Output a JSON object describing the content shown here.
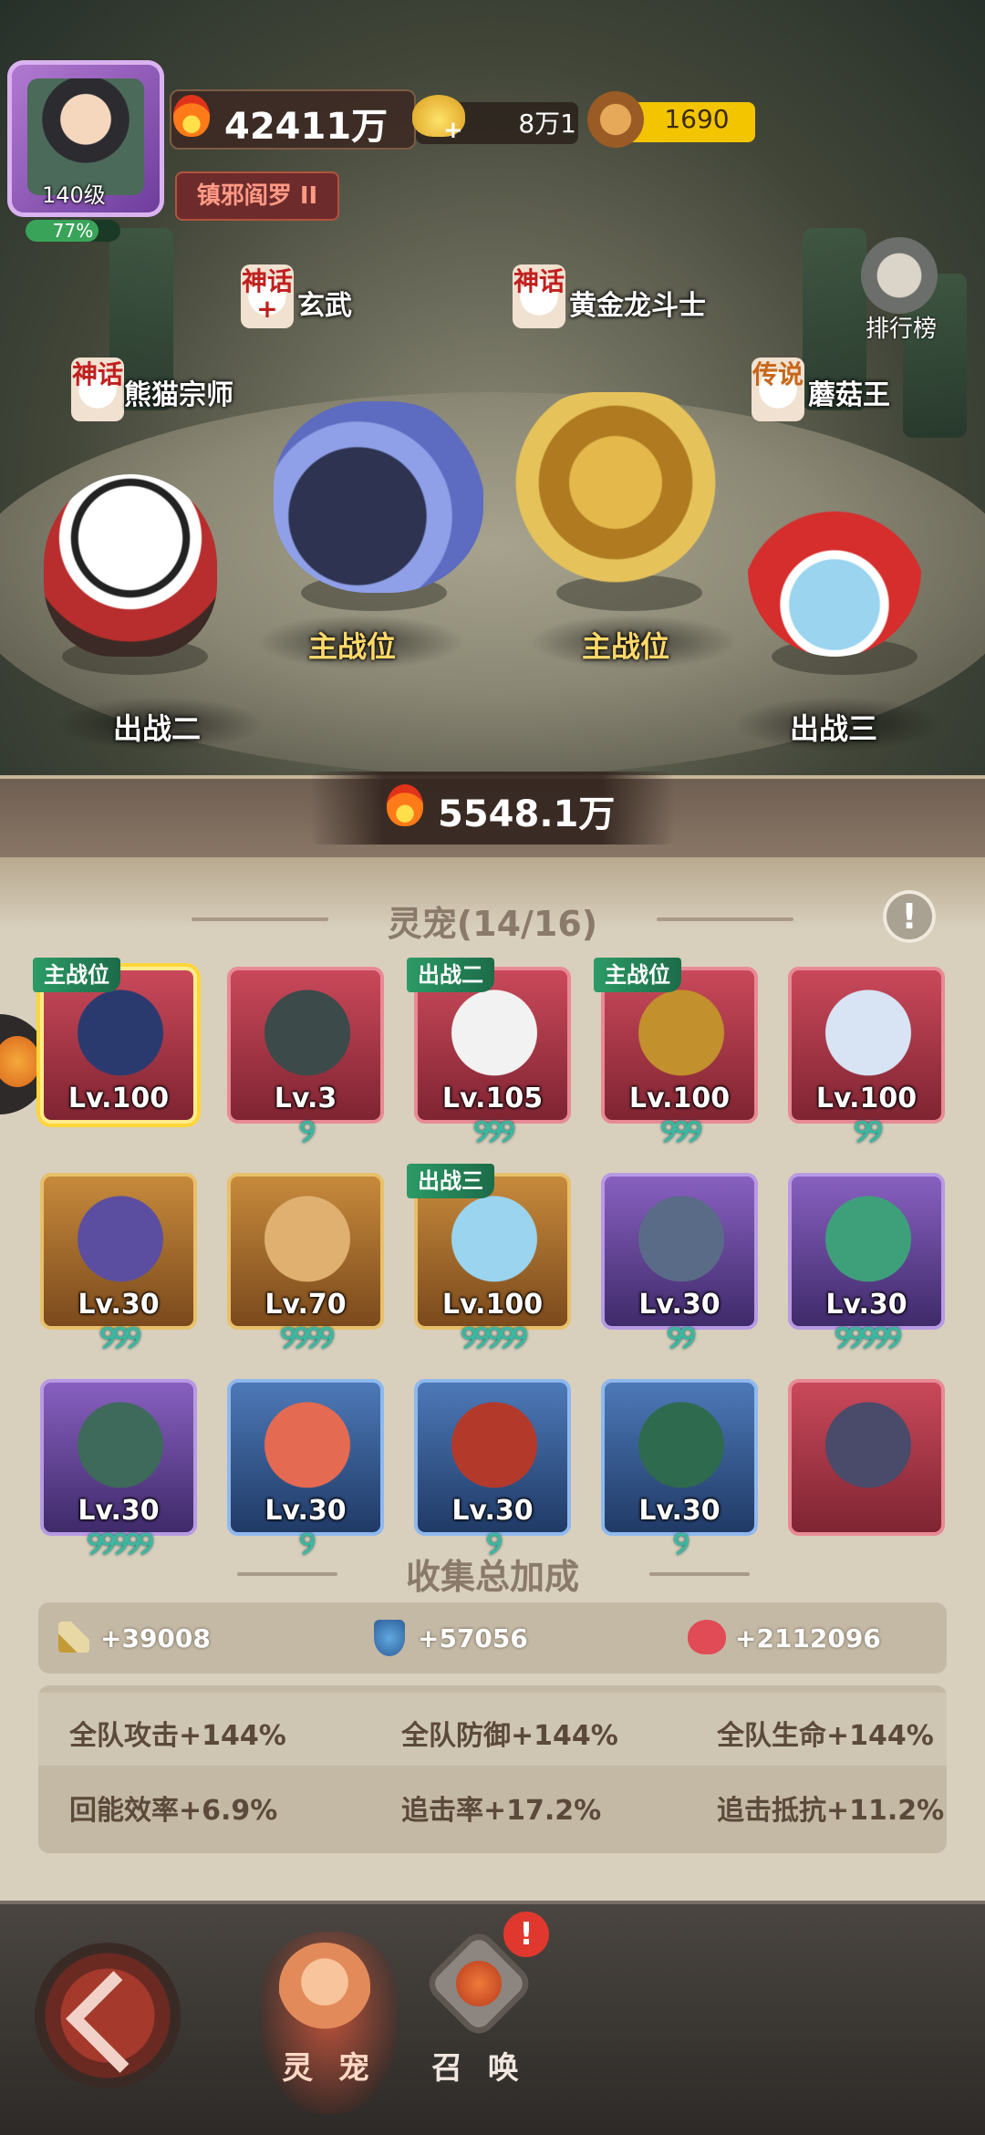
{
  "player": {
    "level": "140级",
    "exp_percent": "77%",
    "exp_fraction": 0.77,
    "power": "42411万",
    "title": "镇邪阎罗 II"
  },
  "currency": {
    "ingot": "8万1",
    "coin": "1690"
  },
  "rank_button": "排行榜",
  "heroes": [
    {
      "tag": "神话",
      "name": "熊猫宗师",
      "slot": "出战二"
    },
    {
      "tag": "神话+",
      "name": "玄武",
      "slot": "主战位"
    },
    {
      "tag": "神话",
      "name": "黄金龙斗士",
      "slot": "主战位"
    },
    {
      "tag": "传说",
      "name": "蘑菇王",
      "slot": "出战三"
    }
  ],
  "team_power": "5548.1万",
  "pets_section": {
    "title": "灵宠(14/16)",
    "info_icon": "exclamation-icon",
    "cards": [
      {
        "level": "Lv.100",
        "rarity": "red",
        "tag": "主战位",
        "stars": "",
        "selected": true
      },
      {
        "level": "Lv.3",
        "rarity": "red",
        "tag": "",
        "stars": "୨"
      },
      {
        "level": "Lv.105",
        "rarity": "red",
        "tag": "出战二",
        "stars": "୨୨୨"
      },
      {
        "level": "Lv.100",
        "rarity": "red",
        "tag": "主战位",
        "stars": "୨୨୨"
      },
      {
        "level": "Lv.100",
        "rarity": "red",
        "tag": "",
        "stars": "୨୨"
      },
      {
        "level": "Lv.30",
        "rarity": "gold",
        "tag": "",
        "stars": "୨୨୨"
      },
      {
        "level": "Lv.70",
        "rarity": "gold",
        "tag": "",
        "stars": "୨୨୨୨"
      },
      {
        "level": "Lv.100",
        "rarity": "gold",
        "tag": "出战三",
        "stars": "୨୨୨୨୨"
      },
      {
        "level": "Lv.30",
        "rarity": "purple",
        "tag": "",
        "stars": "୨୨"
      },
      {
        "level": "Lv.30",
        "rarity": "purple",
        "tag": "",
        "stars": "୨୨୨୨୨"
      },
      {
        "level": "Lv.30",
        "rarity": "purple",
        "tag": "",
        "stars": "୨୨୨୨୨"
      },
      {
        "level": "Lv.30",
        "rarity": "blue",
        "tag": "",
        "stars": "୨"
      },
      {
        "level": "Lv.30",
        "rarity": "blue",
        "tag": "",
        "stars": "୨"
      },
      {
        "level": "Lv.30",
        "rarity": "blue",
        "tag": "",
        "stars": "୨"
      },
      {
        "level": "",
        "rarity": "red",
        "tag": "",
        "stars": ""
      }
    ]
  },
  "collection": {
    "title": "收集总加成",
    "attack": "+39008",
    "defense": "+57056",
    "hp": "+2112096",
    "bonuses": [
      [
        "全队攻击+144%",
        "全队防御+144%",
        "全队生命+144%"
      ],
      [
        "回能效率+6.9%",
        "追击率+17.2%",
        "追击抵抗+11.2%"
      ]
    ]
  },
  "nav": {
    "pet_label": "灵 宠",
    "summon_label": "召 唤",
    "summon_badge": "!"
  },
  "colors": {
    "card_red": "#c9495a",
    "card_gold": "#c78a3c",
    "card_purple": "#8860c0",
    "card_blue": "#4d79b8",
    "tag_green": "#2c9b66",
    "star_teal": "#3ab8a2"
  }
}
